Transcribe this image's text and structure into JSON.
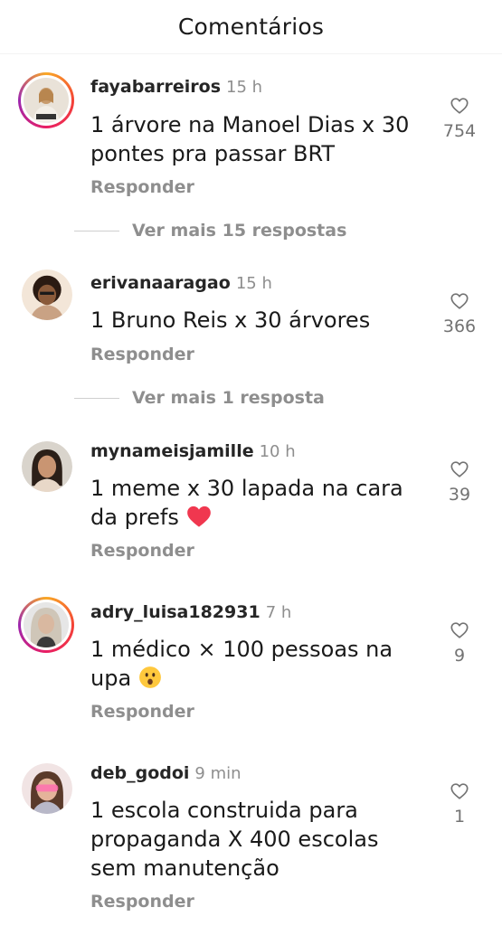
{
  "header": {
    "title": "Comentários"
  },
  "comments": [
    {
      "username": "fayabarreiros",
      "time": "15 h",
      "text_lines": [
        "1 árvore na Manoel Dias x 30",
        "pontes pra passar BRT"
      ],
      "reply_label": "Responder",
      "likes": "754",
      "more_replies": "Ver mais 15 respostas",
      "avatar_ring": true
    },
    {
      "username": "erivanaaragao",
      "time": "15 h",
      "text_lines": [
        "1 Bruno Reis x 30 árvores"
      ],
      "reply_label": "Responder",
      "likes": "366",
      "more_replies": "Ver mais 1 resposta",
      "avatar_ring": false
    },
    {
      "username": "mynameisjamille",
      "time": "10 h",
      "text_lines": [
        "1 meme x 30 lapada na cara",
        "da prefs"
      ],
      "emoji": "red-heart-emoji",
      "reply_label": "Responder",
      "likes": "39",
      "avatar_ring": false
    },
    {
      "username": "adry_luisa182931",
      "time": "7 h",
      "text_lines": [
        "1 médico × 100 pessoas na",
        "upa"
      ],
      "emoji": "surprised-face-emoji",
      "reply_label": "Responder",
      "likes": "9",
      "avatar_ring": true
    },
    {
      "username": "deb_godoi",
      "time": "9 min",
      "text_lines": [
        "1 escola construida para",
        "propaganda X 400 escolas",
        "sem manutenção"
      ],
      "reply_label": "Responder",
      "likes": "1",
      "avatar_ring": false
    }
  ],
  "icons": {
    "like": "heart-outline-icon"
  },
  "colors": {
    "username": "#262626",
    "muted": "#8e8e8e",
    "story_ring": "#e91e63"
  }
}
